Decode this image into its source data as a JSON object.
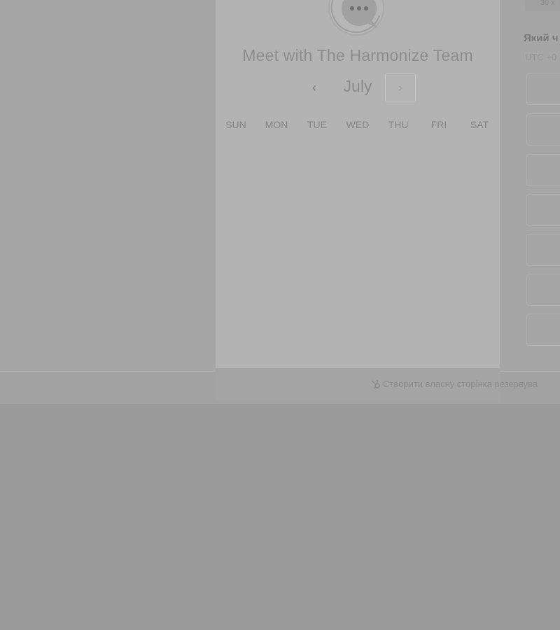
{
  "card": {
    "title": "Meet with The Harmonize Team",
    "month": "July",
    "prev_icon": "‹",
    "next_icon": "›",
    "weekdays": [
      "SUN",
      "MON",
      "TUE",
      "WED",
      "THU",
      "FRI",
      "SAT"
    ]
  },
  "right_panel": {
    "chip_text": "30 x",
    "heading": "Який ч",
    "timezone": "UTC +0"
  },
  "footer": {
    "link_text": "Створити власну сторінка резервува"
  }
}
